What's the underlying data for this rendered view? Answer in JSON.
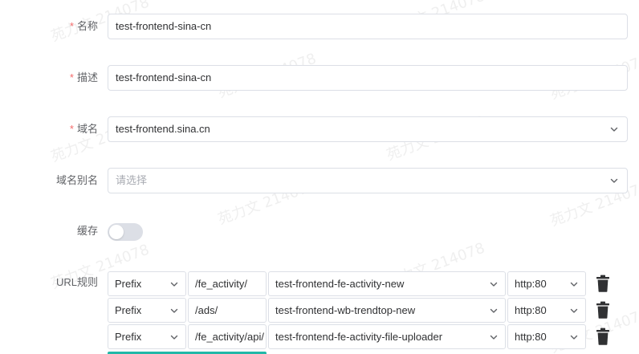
{
  "form": {
    "name": {
      "label": "名称",
      "required_mark": "*",
      "value": "test-frontend-sina-cn"
    },
    "description": {
      "label": "描述",
      "required_mark": "*",
      "value": "test-frontend-sina-cn"
    },
    "domain": {
      "label": "域名",
      "required_mark": "*",
      "value": "test-frontend.sina.cn"
    },
    "domain_alias": {
      "label": "域名别名",
      "placeholder": "请选择"
    },
    "cache": {
      "label": "缓存",
      "enabled": false
    },
    "url_rules": {
      "label": "URL规则",
      "rows": [
        {
          "match_type": "Prefix",
          "path": "/fe_activity/",
          "service": "test-frontend-fe-activity-new",
          "port": "http:80"
        },
        {
          "match_type": "Prefix",
          "path": "/ads/",
          "service": "test-frontend-wb-trendtop-new",
          "port": "http:80"
        },
        {
          "match_type": "Prefix",
          "path": "/fe_activity/api/",
          "service": "test-frontend-fe-activity-file-uploader",
          "port": "http:80"
        }
      ]
    }
  },
  "watermark_text": "苑力文 214078",
  "icons": {
    "select_arrow": "chevron-down-icon",
    "delete": "trash-icon"
  },
  "colors": {
    "required": "#f56c6c",
    "border": "#dcdfe6",
    "label": "#606266",
    "toggle_off": "#dcdfe6",
    "trash": "#303133",
    "accent": "#21b8a8"
  }
}
